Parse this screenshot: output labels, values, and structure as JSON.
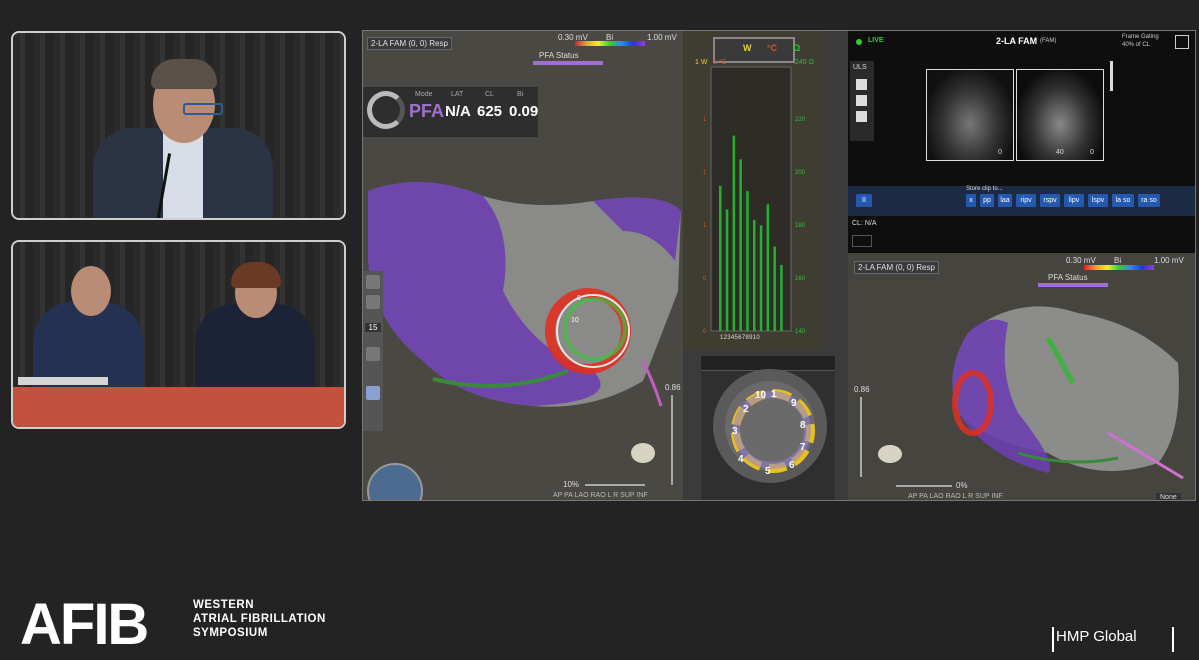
{
  "map_left": {
    "mode_dropdown": "2-LA FAM (0, 0) Resp",
    "scale_min": "0.30 mV",
    "scale_type": "Bi",
    "scale_max": "1.00 mV",
    "pfa_status": "PFA Status",
    "mode_label": "Mode",
    "mode_value": "PFA",
    "lat_label": "LAT",
    "lat_value": "N/A",
    "cl_label": "CL",
    "cl_value": "625",
    "bi_label": "Bi",
    "bi_value": "0.09",
    "opacity_value": "0.86",
    "zoom_value": "10%",
    "counter": "15",
    "electrode_labels": [
      "9",
      "10",
      "1",
      "2",
      "3",
      "5",
      "6",
      "7",
      "8"
    ],
    "view_buttons": "AP PA LAO RAO L R SUP INF"
  },
  "histogram": {
    "legend": [
      "W",
      "°C",
      "Ω"
    ],
    "legend_colors": [
      "#e8d040",
      "#e05020",
      "#30c040"
    ],
    "top_left": "1 W",
    "top_temp": "1 °C",
    "top_right": "240 Ω",
    "y_left_ticks": [
      "1",
      "1",
      "1",
      "0",
      "0",
      "0"
    ],
    "y_right_ticks": [
      "220",
      "200",
      "180",
      "160",
      "140"
    ],
    "x_labels": "12345678910",
    "chart_data": {
      "type": "bar",
      "categories": [
        "1",
        "2",
        "3",
        "4",
        "5",
        "6",
        "7",
        "8",
        "9",
        "10"
      ],
      "values": [
        195,
        186,
        214,
        205,
        193,
        182,
        180,
        188,
        172,
        165
      ],
      "ylim": [
        140,
        240
      ],
      "ylabel": "Ω"
    }
  },
  "ring": {
    "numbers": [
      "1",
      "10",
      "9",
      "8",
      "7",
      "6",
      "5",
      "4",
      "3",
      "2"
    ]
  },
  "ultrasound": {
    "live_label": "LIVE",
    "title": "2-LA FAM",
    "title_sub": "(FAM)",
    "frame_gating": "Frame Gating",
    "frame_gating_value": "40% of CL",
    "uls_label": "ULS",
    "store_clip": "Store clip to...",
    "clip_buttons": [
      "x",
      "pp",
      "laa",
      "ripv",
      "rspv",
      "lipv",
      "lspv",
      "la so",
      "ra so"
    ],
    "cl_text": "CL: N/A",
    "image_labels": [
      "0",
      "40",
      "0"
    ]
  },
  "map_right": {
    "mode_dropdown": "2-LA FAM (0, 0) Resp",
    "scale_min": "0.30 mV",
    "scale_type": "Bi",
    "scale_max": "1.00 mV",
    "pfa_status": "PFA Status",
    "opacity_value": "0.86",
    "zoom_value": "0%",
    "none_button": "None",
    "view_buttons": "AP PA LAO RAO L R SUP INF"
  },
  "footer": {
    "logo": "AFIB",
    "symposium_line1": "WESTERN",
    "symposium_line2": "ATRIAL FIBRILLATION",
    "symposium_line3": "SYMPOSIUM",
    "sponsor": "HMP Global"
  }
}
